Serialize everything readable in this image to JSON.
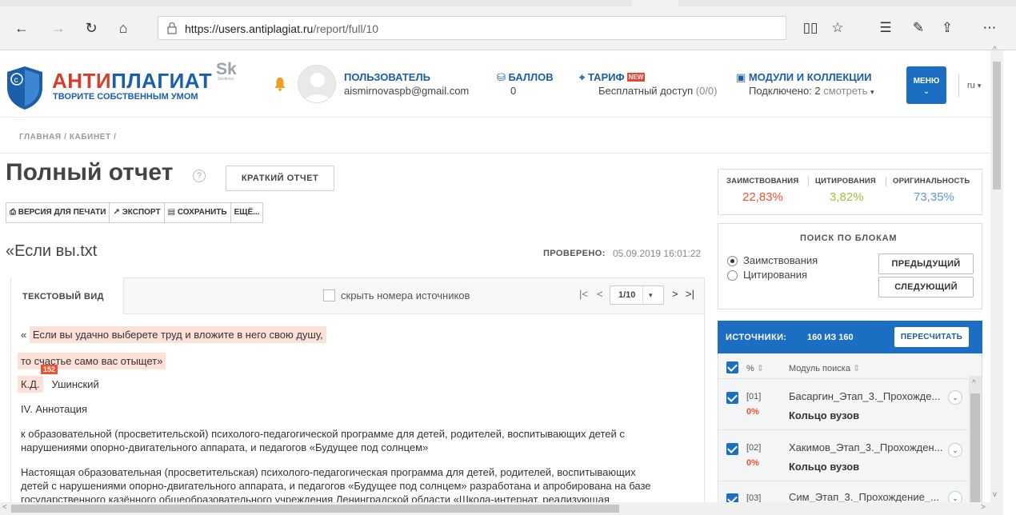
{
  "browser": {
    "url_host": "https://users.antiplagiat.ru",
    "url_path": "/report/full/10"
  },
  "header": {
    "logo_part1": "АНТИ",
    "logo_part2": "ПЛАГИАТ",
    "slogan": "ТВОРИТЕ СОБСТВЕННЫМ УМОМ",
    "sk": "Sk",
    "sk_small": "Skolkovo",
    "user_label": "ПОЛЬЗОВАТЕЛЬ",
    "user_email": "aismirnovaspb@gmail.com",
    "points_label": "БАЛЛОВ",
    "points_value": "0",
    "tariff_label": "ТАРИФ",
    "tariff_badge": "NEW",
    "tariff_value": "Бесплатный доступ",
    "tariff_quota": "(0/0)",
    "modules_label": "МОДУЛИ И КОЛЛЕКЦИИ",
    "modules_value": "Подключено: 2",
    "modules_link": "смотреть",
    "menu_label": "МЕНЮ",
    "lang": "ru"
  },
  "breadcrumb": "ГЛАВНАЯ / КАБИНЕТ /",
  "report": {
    "title": "Полный отчет",
    "short_report": "КРАТКИЙ ОТЧЕТ",
    "toolbar": {
      "print": "ВЕРСИЯ ДЛЯ ПЕЧАТИ",
      "export": "ЭКСПОРТ",
      "save": "СОХРАНИТЬ",
      "more": "ЕЩЁ..."
    },
    "doc_name": "«Если вы.txt",
    "checked_label": "ПРОВЕРЕНО:",
    "checked_date": "05.09.2019 16:01:22"
  },
  "panel": {
    "tab": "ТЕКСТОВЫЙ ВИД",
    "hide_numbers": "скрыть номера источников",
    "page": "1/10",
    "lines": [
      "Если вы удачно выберете труд и вложите в него свою душу,",
      "то счастье само вас отыщет»",
      "К.Д.",
      "Ушинский",
      "IV. Аннотация",
      "к образовательной (просветительской) психолого-педагогической программе для детей, родителей, воспитывающих детей с",
      "нарушениями опорно-двигательного аппарата, и педагогов «Будущее под солнцем»",
      "Настоящая образовательная (просветительская) психолого-педагогическая программа для детей, родителей, воспитывающих",
      "детей с нарушениями опорно-двигательного аппарата, и педагогов «Будущее под солнцем» разработана и апробирована на базе",
      "государственного казённого общеобразовательного учреждения Ленинградской области «Школа-интернат, реализующая"
    ],
    "quote_mark": "«",
    "source_tag": "152"
  },
  "stats": {
    "borrow_label": "ЗАИМСТВОВАНИЯ",
    "borrow_value": "22,83%",
    "cite_label": "ЦИТИРОВАНИЯ",
    "cite_value": "3,82%",
    "orig_label": "ОРИГИНАЛЬНОСТЬ",
    "orig_value": "73,35%",
    "colors": {
      "borrow": "#f0522f",
      "cite": "#9fc03b",
      "orig": "#5b9bd5"
    }
  },
  "block_search": {
    "title": "ПОИСК ПО БЛОКАМ",
    "option1": "Заимствования",
    "option2": "Цитирования",
    "prev": "ПРЕДЫДУЩИЙ",
    "next": "СЛЕДУЮЩИЙ"
  },
  "sources": {
    "title": "ИСТОЧНИКИ:",
    "count": "160 ИЗ 160",
    "recalc": "ПЕРЕСЧИТАТЬ",
    "col_pct": "%",
    "col_module": "Модуль поиска",
    "items": [
      {
        "idx": "[01]",
        "pct": "0%",
        "name": "Басаргин_Этап_3._Прохожде...",
        "module": "Кольцо вузов"
      },
      {
        "idx": "[02]",
        "pct": "0%",
        "name": "Хакимов_Этап_3._Прохожден...",
        "module": "Кольцо вузов"
      },
      {
        "idx": "[03]",
        "pct": "",
        "name": "Сим_Этап_3._Прохождение_...",
        "module": ""
      }
    ]
  }
}
